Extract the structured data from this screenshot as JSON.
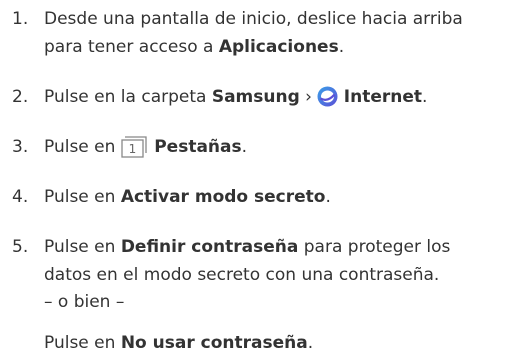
{
  "steps": [
    {
      "number": "1.",
      "line1": "Desde una pantalla de inicio, deslice hacia arriba",
      "line2_pre": "para tener acceso a ",
      "line2_bold": "Aplicaciones",
      "line2_post": "."
    },
    {
      "number": "2.",
      "pre": "Pulse en la carpeta ",
      "bold1": "Samsung",
      "sep": " › ",
      "icon": "samsung-internet-icon",
      "bold2": "Internet",
      "post": "."
    },
    {
      "number": "3.",
      "pre": "Pulse en ",
      "icon": "tabs-icon",
      "icon_text": "1",
      "bold": "Pestañas",
      "post": "."
    },
    {
      "number": "4.",
      "pre": "Pulse en ",
      "bold": "Activar modo secreto",
      "post": "."
    },
    {
      "number": "5.",
      "pre": "Pulse en ",
      "bold": "Definir contraseña",
      "post1": " para proteger los",
      "line2": "datos en el modo secreto con una contraseña."
    }
  ],
  "or_text": "– o bien –",
  "alternative": {
    "pre": "Pulse en ",
    "bold": "No usar contraseña",
    "post": "."
  },
  "colors": {
    "text": "#333333",
    "icon_purple": "#5b4fd6",
    "icon_blue": "#3aa0e8"
  }
}
